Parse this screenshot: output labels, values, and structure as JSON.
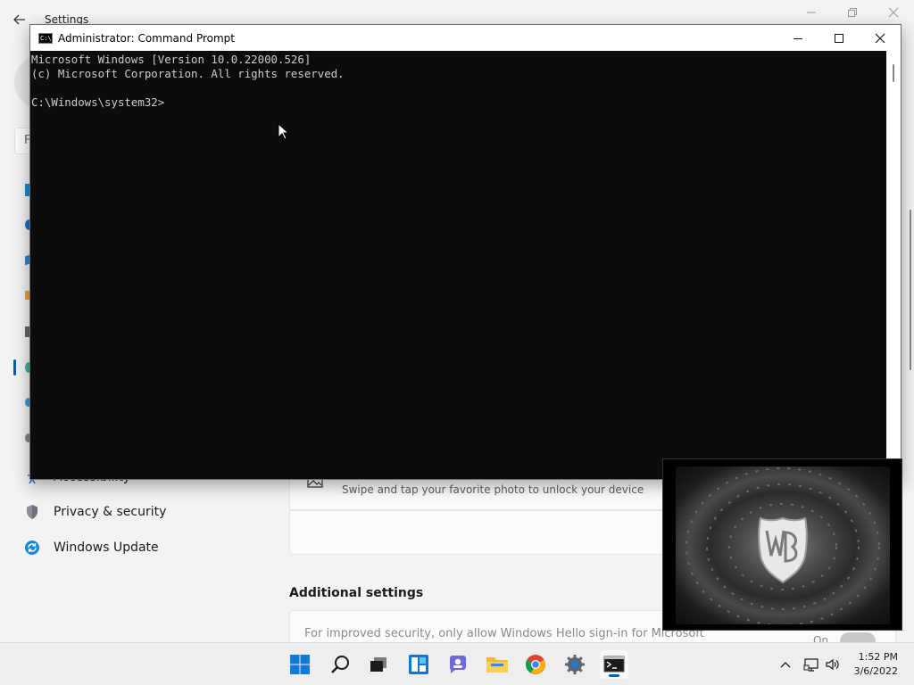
{
  "settings": {
    "title": "Settings",
    "search_partial": "F",
    "nav": [
      {
        "label": "Accessibility",
        "icon": "person-accessibility-icon"
      },
      {
        "label": "Privacy & security",
        "icon": "shield-icon"
      },
      {
        "label": "Windows Update",
        "icon": "refresh-sync-icon"
      }
    ],
    "picture_password_desc": "Swipe and tap your favorite photo to unlock your device",
    "additional_settings_title": "Additional settings",
    "hello_only_text": "For improved security, only allow Windows Hello sign-in for Microsoft",
    "toggle_text": "On"
  },
  "cmd": {
    "title": "Administrator: Command Prompt",
    "app_icon_text": "C:\\",
    "lines": [
      "Microsoft Windows [Version 10.0.22000.526]",
      "(c) Microsoft Corporation. All rights reserved.",
      "",
      "C:\\Windows\\system32>"
    ]
  },
  "taskbar": {
    "apps": [
      {
        "name": "start-button",
        "icon": "windows-logo-icon"
      },
      {
        "name": "search-button",
        "icon": "search-icon"
      },
      {
        "name": "task-view-button",
        "icon": "task-view-icon"
      },
      {
        "name": "widgets-button",
        "icon": "widgets-icon"
      },
      {
        "name": "teams-chat-button",
        "icon": "teams-chat-icon"
      },
      {
        "name": "file-explorer-button",
        "icon": "folder-icon"
      },
      {
        "name": "chrome-button",
        "icon": "chrome-icon"
      },
      {
        "name": "settings-button",
        "icon": "gear-icon"
      },
      {
        "name": "command-prompt-button",
        "icon": "terminal-icon",
        "active": true
      }
    ],
    "time": "1:52 PM",
    "date": "3/6/2022"
  },
  "colors": {
    "accent": "#005fb8",
    "cmd_bg": "#0c0c0c",
    "cmd_text": "#cccccc",
    "settings_bg": "#f3f3f3"
  }
}
